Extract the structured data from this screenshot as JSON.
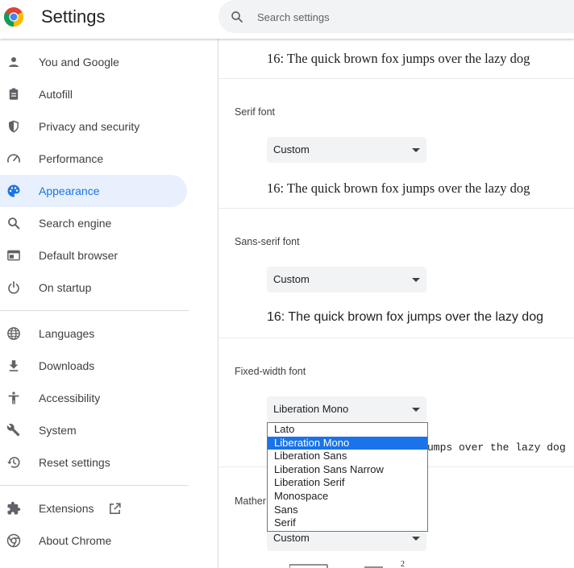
{
  "header": {
    "title": "Settings",
    "logo_icon": "chrome-logo-icon",
    "search_icon": "search-icon",
    "search_placeholder": "Search settings"
  },
  "sidebar": {
    "items": [
      {
        "label": "You and Google",
        "icon": "person-icon"
      },
      {
        "label": "Autofill",
        "icon": "clipboard-icon"
      },
      {
        "label": "Privacy and security",
        "icon": "shield-icon"
      },
      {
        "label": "Performance",
        "icon": "speedometer-icon"
      },
      {
        "label": "Appearance",
        "icon": "palette-icon",
        "active": true
      },
      {
        "label": "Search engine",
        "icon": "search-icon"
      },
      {
        "label": "Default browser",
        "icon": "browser-window-icon"
      },
      {
        "label": "On startup",
        "icon": "power-icon"
      },
      {
        "label": "Languages",
        "icon": "globe-icon"
      },
      {
        "label": "Downloads",
        "icon": "download-icon"
      },
      {
        "label": "Accessibility",
        "icon": "accessibility-icon"
      },
      {
        "label": "System",
        "icon": "wrench-icon"
      },
      {
        "label": "Reset settings",
        "icon": "history-reset-icon"
      },
      {
        "label": "Extensions",
        "icon": "puzzle-icon",
        "trailing_icon": "open-external-icon"
      },
      {
        "label": "About Chrome",
        "icon": "chrome-logo-icon"
      }
    ]
  },
  "main": {
    "top_sample": "16: The quick brown fox jumps over the lazy dog",
    "serif": {
      "label": "Serif font",
      "value": "Custom",
      "sample": "16: The quick brown fox jumps over the lazy dog"
    },
    "sans_serif": {
      "label": "Sans-serif font",
      "value": "Custom",
      "sample": "16: The quick brown fox jumps over the lazy dog"
    },
    "fixed_width": {
      "label": "Fixed-width font",
      "value": "Liberation Mono",
      "sample_visible": "umps over the lazy dog"
    },
    "math": {
      "label_visible": "Mather",
      "value": "Custom"
    }
  },
  "dropdown": {
    "options": [
      "Lato",
      "Liberation Mono",
      "Liberation Sans",
      "Liberation Sans Narrow",
      "Liberation Serif",
      "Monospace",
      "Sans",
      "Serif"
    ],
    "selected": "Liberation Mono"
  },
  "colors": {
    "accent": "#1a73e8",
    "active_nav_bg": "#e8f0fe",
    "select_bg": "#f1f3f4",
    "divider": "#dadce0"
  }
}
